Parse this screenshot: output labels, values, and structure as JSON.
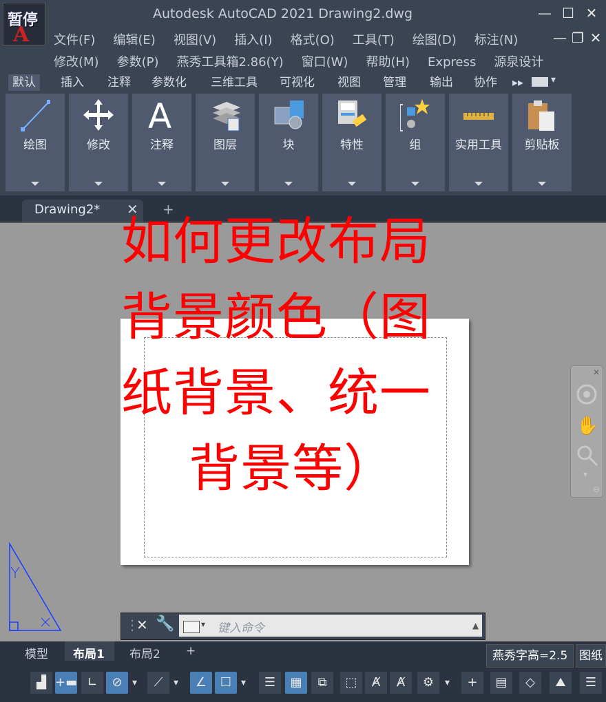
{
  "app": {
    "title": "Autodesk AutoCAD 2021     Drawing2.dwg",
    "logo_text": "暂停",
    "window_buttons": [
      "—",
      "☐",
      "✕"
    ],
    "doc_window_buttons": [
      "—",
      "❐",
      "✕"
    ]
  },
  "menu_row1": [
    "文件(F)",
    "编辑(E)",
    "视图(V)",
    "插入(I)",
    "格式(O)",
    "工具(T)",
    "绘图(D)",
    "标注(N)"
  ],
  "menu_row2": [
    "修改(M)",
    "参数(P)",
    "燕秀工具箱2.86(Y)",
    "窗口(W)",
    "帮助(H)",
    "Express",
    "源泉设计"
  ],
  "ribbon_tabs": [
    "默认",
    "插入",
    "注释",
    "参数化",
    "三维工具",
    "可视化",
    "视图",
    "管理",
    "输出",
    "协作"
  ],
  "ribbon_panels": [
    {
      "label": "绘图",
      "icon": "line-icon"
    },
    {
      "label": "修改",
      "icon": "move-icon"
    },
    {
      "label": "注释",
      "icon": "text-icon"
    },
    {
      "label": "图层",
      "icon": "layers-icon"
    },
    {
      "label": "块",
      "icon": "block-icon"
    },
    {
      "label": "特性",
      "icon": "properties-icon"
    },
    {
      "label": "组",
      "icon": "group-icon"
    },
    {
      "label": "实用工具",
      "icon": "ruler-icon"
    },
    {
      "label": "剪贴板",
      "icon": "clipboard-icon"
    }
  ],
  "doc_tab": {
    "label": "Drawing2*",
    "close": "✕",
    "add": "+"
  },
  "overlay_text": "如何更改布局\n背景颜色（图\n纸背景、统一\n    背景等）",
  "command": {
    "placeholder": "键入命令"
  },
  "layout_tabs": {
    "model": "模型",
    "layout1": "布局1",
    "layout2": "布局2",
    "add": "+"
  },
  "status": {
    "text_height": "燕秀字高=2.5",
    "paper": "图纸"
  },
  "colors": {
    "overlay": "#ff0000",
    "accent_active": "#4a7fb5"
  }
}
